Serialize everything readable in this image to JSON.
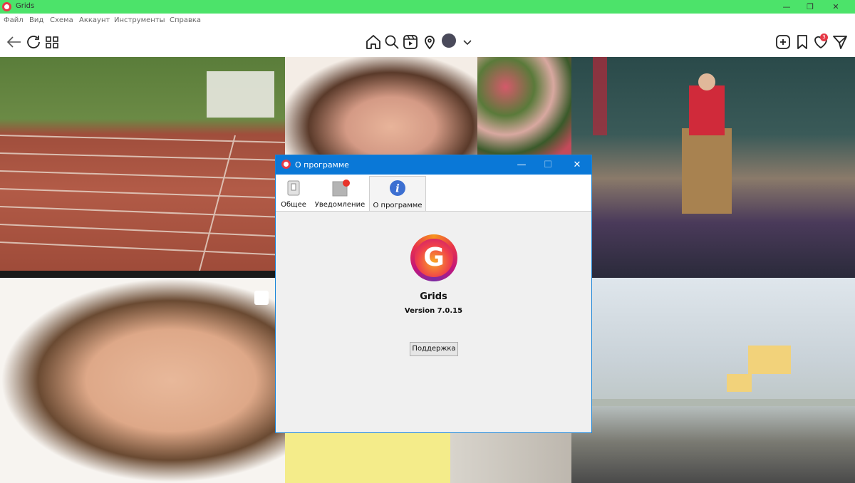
{
  "window": {
    "title": "Grids",
    "minimize": "—",
    "maximize": "❐",
    "close": "✕"
  },
  "menu": [
    "Файл",
    "Вид",
    "Схема",
    "Аккаунт",
    "Инструменты",
    "Справка"
  ],
  "toolbar": {
    "notification_count": "3"
  },
  "dialog": {
    "title": "О программе",
    "minimize": "—",
    "maximize": "☐",
    "close": "✕",
    "tabs": [
      {
        "label": "Общее"
      },
      {
        "label": "Уведомление"
      },
      {
        "label": "О программе"
      }
    ],
    "app_logo_letter": "G",
    "app_name": "Grids",
    "version": "Version 7.0.15",
    "support_button": "Поддержка"
  },
  "colors": {
    "titlebar": "#4ce36a",
    "dialog_titlebar": "#0a78d7",
    "notification_badge": "#e63946",
    "info_icon": "#3c6fd1"
  }
}
